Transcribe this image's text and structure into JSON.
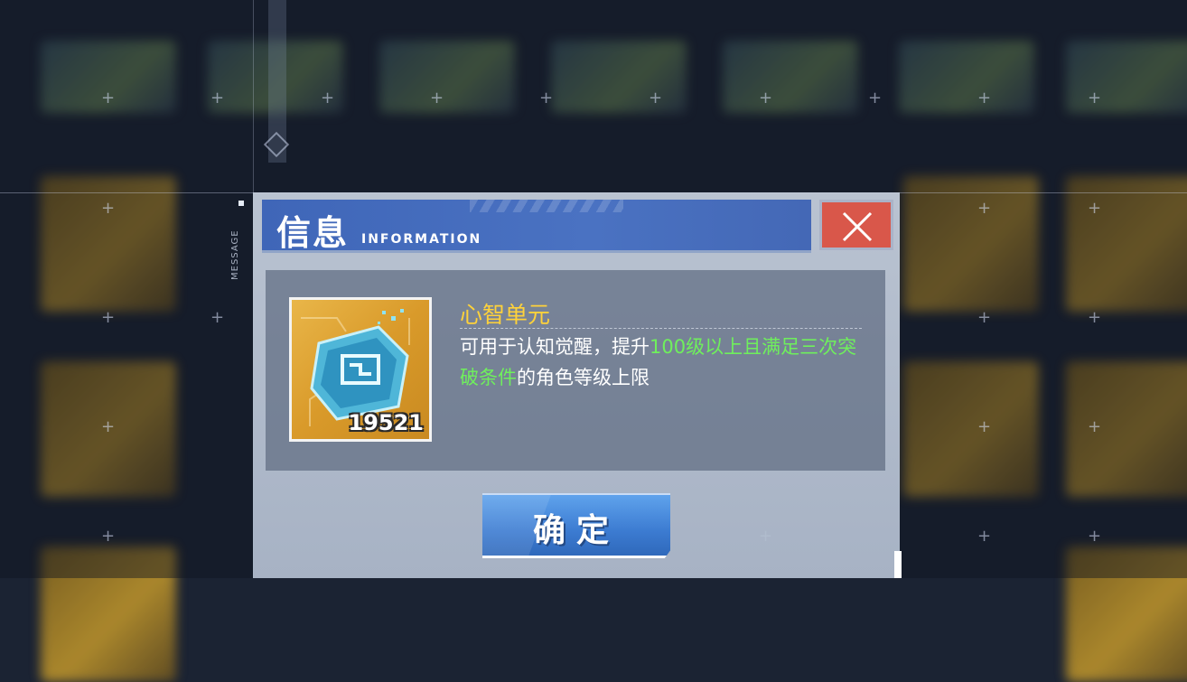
{
  "background": {
    "side_label": "MESSAGE"
  },
  "dialog": {
    "title_cn": "信息",
    "title_en": "INFORMATION",
    "close_icon": "close-x-icon",
    "item": {
      "icon": "chip-icon",
      "count": "19521",
      "name": "心智单元",
      "description_parts": {
        "p1": "可用于认知觉醒，提升",
        "p2_highlight": "100级以上且满足三次突破条件",
        "p3": "的角色等级上限"
      }
    },
    "confirm_label": "确定"
  },
  "colors": {
    "header": "#4a72c2",
    "close": "#d9574a",
    "item_name": "#ffd23a",
    "highlight": "#6ff05c",
    "confirm": "#3c7bd1"
  }
}
